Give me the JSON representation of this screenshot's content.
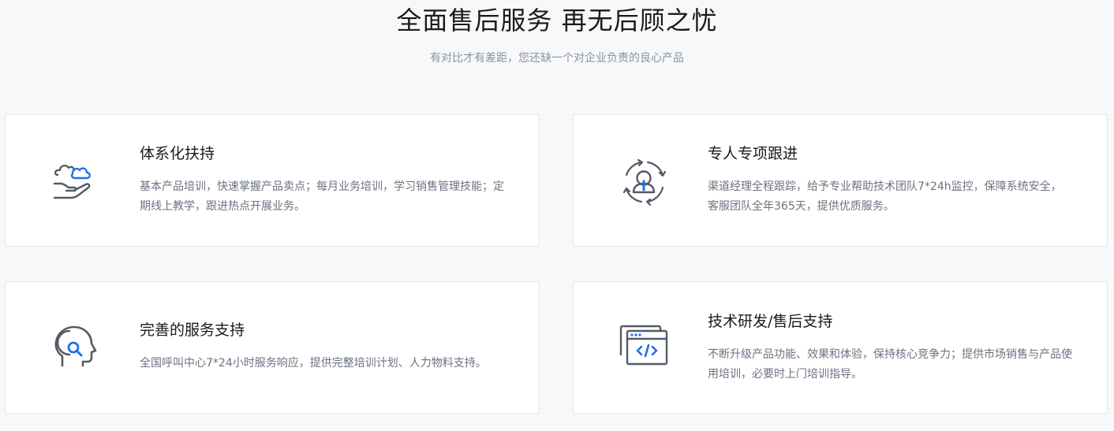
{
  "section": {
    "title": "全面售后服务 再无后顾之忧",
    "subtitle": "有对比才有差距，您还缺一个对企业负责的良心产品"
  },
  "colors": {
    "accent": "#1e6ff0",
    "icon_stroke": "#555b66",
    "title_text": "#1a1a1a",
    "desc_text": "#6b7280",
    "background": "#f7f8fa",
    "card_border": "#e3e6eb"
  },
  "cards": [
    {
      "icon": "hand-cloud-icon",
      "title": "体系化扶持",
      "description": "基本产品培训，快速掌握产品卖点；每月业务培训，学习销售管理技能；定期线上教学，跟进热点开展业务。"
    },
    {
      "icon": "person-refresh-icon",
      "title": "专人专项跟进",
      "description": "渠道经理全程跟踪，给予专业帮助技术团队7*24h监控，保障系统安全，客服团队全年365天，提供优质服务。"
    },
    {
      "icon": "head-search-icon",
      "title": "完善的服务支持",
      "description": "全国呼叫中心7*24小时服务响应，提供完整培训计划、人力物料支持。"
    },
    {
      "icon": "code-window-icon",
      "title": "技术研发/售后支持",
      "description": "不断升级产品功能、效果和体验，保持核心竞争力；提供市场销售与产品使用培训，必要时上门培训指导。"
    }
  ]
}
